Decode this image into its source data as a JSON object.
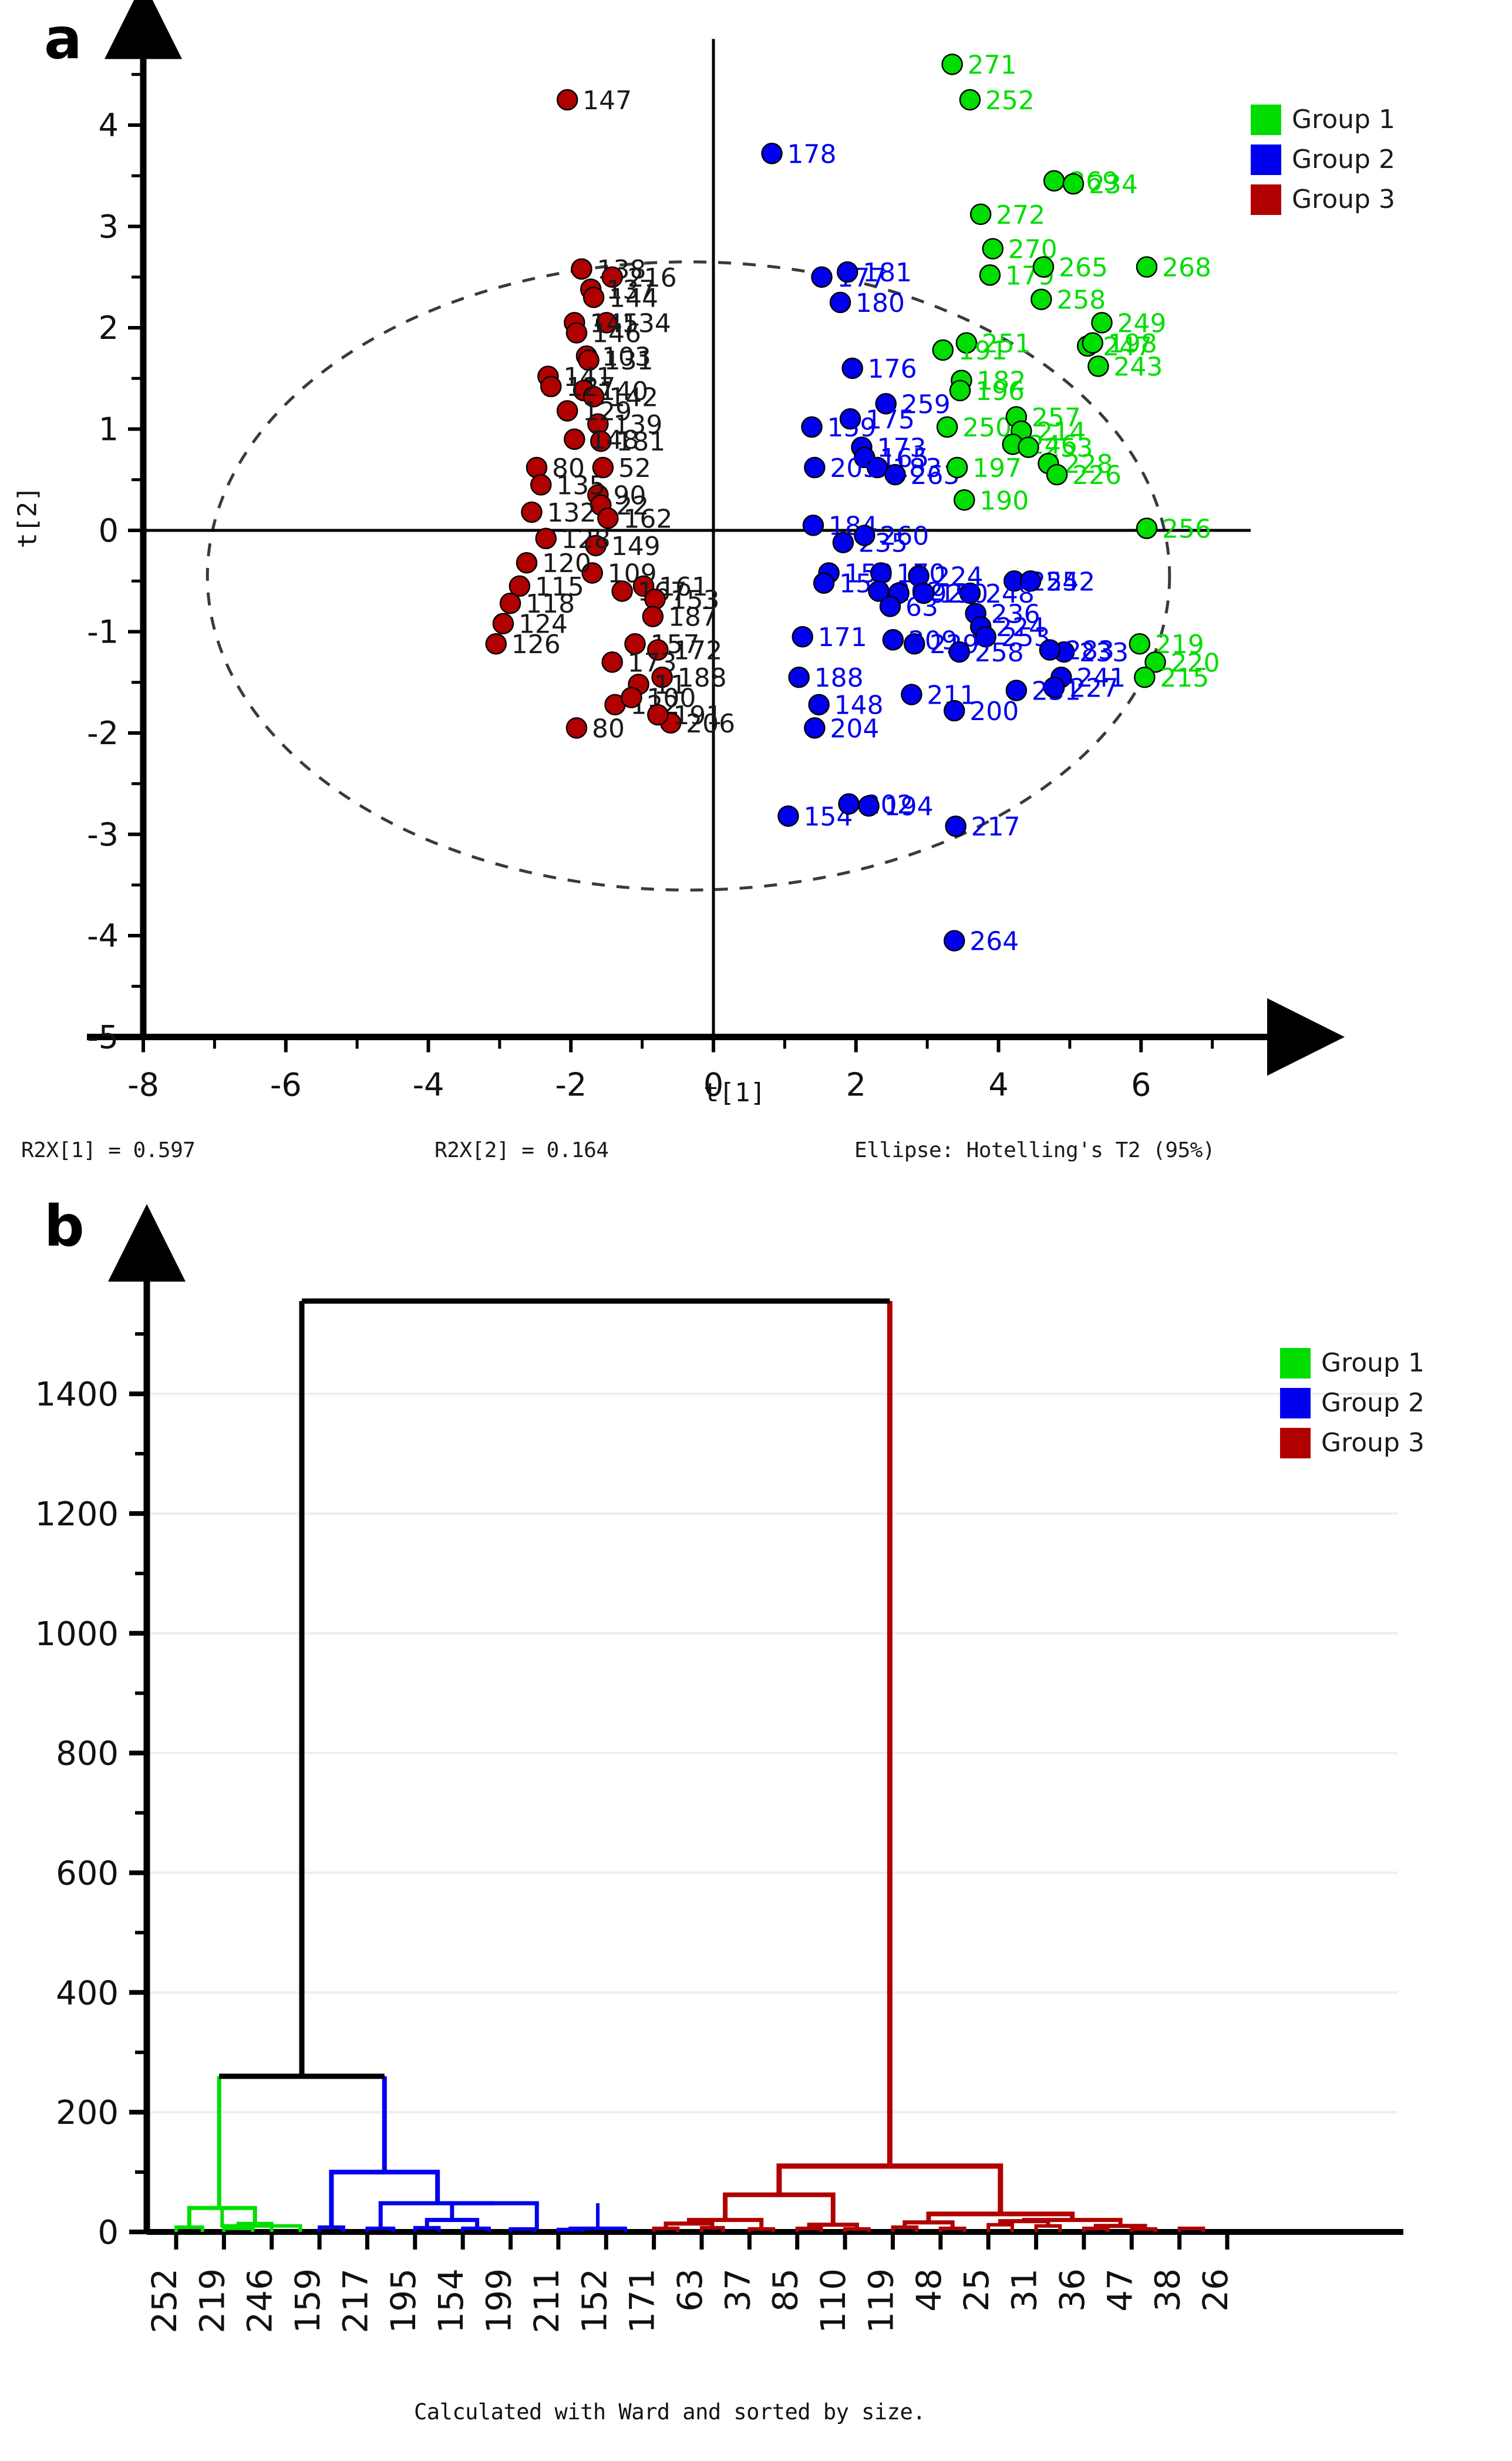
{
  "figure": {
    "panel_a_letter": "a",
    "panel_b_letter": "b"
  },
  "legend": {
    "items": [
      {
        "label": "Group 1",
        "color": "#00dd00"
      },
      {
        "label": "Group 2",
        "color": "#0000ee"
      },
      {
        "label": "Group 3",
        "color": "#b00000"
      }
    ]
  },
  "panel_a": {
    "stats": {
      "r2x1": "R2X[1] = 0.597",
      "r2x2": "R2X[2] = 0.164",
      "ellipse": "Ellipse: Hotelling's T2 (95%)"
    },
    "chart_data": {
      "type": "scatter",
      "title": "",
      "xlabel": "t[1]",
      "ylabel": "t[2]",
      "xlim": [
        -8,
        7
      ],
      "ylim": [
        -5,
        4.8
      ],
      "xticks": [
        -8,
        -6,
        -4,
        -2,
        0,
        2,
        4,
        6
      ],
      "yticks": [
        -5,
        -4,
        -3,
        -2,
        -1,
        0,
        1,
        2,
        3,
        4
      ],
      "grid": false,
      "legend_position": "top-right",
      "annotations": [
        "Hotelling's T2 95% confidence ellipse (dashed)"
      ],
      "ellipse": {
        "cx": -0.35,
        "cy": -0.45,
        "rx": 6.75,
        "ry": 3.1
      },
      "series": [
        {
          "name": "Group 1",
          "color": "#00dd00",
          "points": [
            {
              "label": "271",
              "x": 3.35,
              "y": 4.6
            },
            {
              "label": "252",
              "x": 3.6,
              "y": 4.25
            },
            {
              "label": "269",
              "x": 4.78,
              "y": 3.45
            },
            {
              "label": "234",
              "x": 5.05,
              "y": 3.42
            },
            {
              "label": "272",
              "x": 3.75,
              "y": 3.12
            },
            {
              "label": "270",
              "x": 3.92,
              "y": 2.78
            },
            {
              "label": "179",
              "x": 3.88,
              "y": 2.52
            },
            {
              "label": "265",
              "x": 4.63,
              "y": 2.6
            },
            {
              "label": "258",
              "x": 4.6,
              "y": 2.28
            },
            {
              "label": "268",
              "x": 6.08,
              "y": 2.6
            },
            {
              "label": "249",
              "x": 5.45,
              "y": 2.05
            },
            {
              "label": "247",
              "x": 5.25,
              "y": 1.82
            },
            {
              "label": "198",
              "x": 5.32,
              "y": 1.85
            },
            {
              "label": "243",
              "x": 5.4,
              "y": 1.62
            },
            {
              "label": "251",
              "x": 3.55,
              "y": 1.85
            },
            {
              "label": "191",
              "x": 3.22,
              "y": 1.78
            },
            {
              "label": "182",
              "x": 3.48,
              "y": 1.48
            },
            {
              "label": "196",
              "x": 3.46,
              "y": 1.38
            },
            {
              "label": "250",
              "x": 3.28,
              "y": 1.02
            },
            {
              "label": "257",
              "x": 4.25,
              "y": 1.12
            },
            {
              "label": "214",
              "x": 4.32,
              "y": 0.98
            },
            {
              "label": "246",
              "x": 4.2,
              "y": 0.85
            },
            {
              "label": "253",
              "x": 4.42,
              "y": 0.82
            },
            {
              "label": "228",
              "x": 4.7,
              "y": 0.66
            },
            {
              "label": "226",
              "x": 4.82,
              "y": 0.55
            },
            {
              "label": "197",
              "x": 3.42,
              "y": 0.62
            },
            {
              "label": "190",
              "x": 3.52,
              "y": 0.3
            },
            {
              "label": "256",
              "x": 6.08,
              "y": 0.02
            },
            {
              "label": "219",
              "x": 5.98,
              "y": -1.12
            },
            {
              "label": "220",
              "x": 6.2,
              "y": -1.3
            },
            {
              "label": "215",
              "x": 6.05,
              "y": -1.45
            }
          ]
        },
        {
          "name": "Group 2",
          "color": "#0000ee",
          "points": [
            {
              "label": "178",
              "x": 0.82,
              "y": 3.72
            },
            {
              "label": "177",
              "x": 1.52,
              "y": 2.5
            },
            {
              "label": "181",
              "x": 1.88,
              "y": 2.55
            },
            {
              "label": "180",
              "x": 1.78,
              "y": 2.25
            },
            {
              "label": "176",
              "x": 1.95,
              "y": 1.6
            },
            {
              "label": "259",
              "x": 2.42,
              "y": 1.25
            },
            {
              "label": "175",
              "x": 1.92,
              "y": 1.1
            },
            {
              "label": "159",
              "x": 1.38,
              "y": 1.02
            },
            {
              "label": "173",
              "x": 2.08,
              "y": 0.82
            },
            {
              "label": "165",
              "x": 2.12,
              "y": 0.72
            },
            {
              "label": "183",
              "x": 2.3,
              "y": 0.62
            },
            {
              "label": "205",
              "x": 1.42,
              "y": 0.62
            },
            {
              "label": "263",
              "x": 2.55,
              "y": 0.55
            },
            {
              "label": "184",
              "x": 1.4,
              "y": 0.05
            },
            {
              "label": "235",
              "x": 1.82,
              "y": -0.12
            },
            {
              "label": "260",
              "x": 2.12,
              "y": -0.05
            },
            {
              "label": "150",
              "x": 1.62,
              "y": -0.42
            },
            {
              "label": "158",
              "x": 1.55,
              "y": -0.52
            },
            {
              "label": "170",
              "x": 2.35,
              "y": -0.42
            },
            {
              "label": "224",
              "x": 2.88,
              "y": -0.45
            },
            {
              "label": "255",
              "x": 4.22,
              "y": -0.5
            },
            {
              "label": "242",
              "x": 4.45,
              "y": -0.5
            },
            {
              "label": "248",
              "x": 3.6,
              "y": -0.62
            },
            {
              "label": "262",
              "x": 2.32,
              "y": -0.6
            },
            {
              "label": "192",
              "x": 2.6,
              "y": -0.62
            },
            {
              "label": "190b",
              "x": 2.95,
              "y": -0.62
            },
            {
              "label": "236",
              "x": 3.68,
              "y": -0.82
            },
            {
              "label": "63",
              "x": 2.48,
              "y": -0.75
            },
            {
              "label": "224b",
              "x": 3.75,
              "y": -0.95
            },
            {
              "label": "253b",
              "x": 3.82,
              "y": -1.05
            },
            {
              "label": "171",
              "x": 1.25,
              "y": -1.05
            },
            {
              "label": "209",
              "x": 2.52,
              "y": -1.08
            },
            {
              "label": "229",
              "x": 2.82,
              "y": -1.12
            },
            {
              "label": "258b",
              "x": 3.45,
              "y": -1.2
            },
            {
              "label": "233",
              "x": 4.92,
              "y": -1.2
            },
            {
              "label": "283",
              "x": 4.72,
              "y": -1.18
            },
            {
              "label": "241",
              "x": 4.88,
              "y": -1.45
            },
            {
              "label": "227",
              "x": 4.78,
              "y": -1.55
            },
            {
              "label": "231",
              "x": 4.25,
              "y": -1.58
            },
            {
              "label": "188",
              "x": 1.2,
              "y": -1.45
            },
            {
              "label": "211",
              "x": 2.78,
              "y": -1.62
            },
            {
              "label": "200",
              "x": 3.38,
              "y": -1.78
            },
            {
              "label": "148",
              "x": 1.48,
              "y": -1.72
            },
            {
              "label": "204",
              "x": 1.42,
              "y": -1.95
            },
            {
              "label": "154",
              "x": 1.05,
              "y": -2.82
            },
            {
              "label": "202",
              "x": 1.9,
              "y": -2.7
            },
            {
              "label": "194",
              "x": 2.18,
              "y": -2.72
            },
            {
              "label": "217",
              "x": 3.4,
              "y": -2.92
            },
            {
              "label": "264",
              "x": 3.38,
              "y": -4.05
            }
          ]
        },
        {
          "name": "Group 3",
          "color": "#b00000",
          "points": [
            {
              "label": "147",
              "x": -2.05,
              "y": 4.25
            },
            {
              "label": "138",
              "x": -1.85,
              "y": 2.58
            },
            {
              "label": "216",
              "x": -1.42,
              "y": 2.5
            },
            {
              "label": "137",
              "x": -1.72,
              "y": 2.38
            },
            {
              "label": "144",
              "x": -1.68,
              "y": 2.3
            },
            {
              "label": "134",
              "x": -1.5,
              "y": 2.05
            },
            {
              "label": "145",
              "x": -1.95,
              "y": 2.05
            },
            {
              "label": "146",
              "x": -1.92,
              "y": 1.95
            },
            {
              "label": "103",
              "x": -1.78,
              "y": 1.72
            },
            {
              "label": "131",
              "x": -1.75,
              "y": 1.68
            },
            {
              "label": "141",
              "x": -2.32,
              "y": 1.52
            },
            {
              "label": "140",
              "x": -1.82,
              "y": 1.38
            },
            {
              "label": "142",
              "x": -1.68,
              "y": 1.32
            },
            {
              "label": "139",
              "x": -1.62,
              "y": 1.05
            },
            {
              "label": "181r",
              "x": -1.58,
              "y": 0.88
            },
            {
              "label": "148r",
              "x": -1.95,
              "y": 0.9
            },
            {
              "label": "52",
              "x": -1.55,
              "y": 0.62
            },
            {
              "label": "80a",
              "x": -2.48,
              "y": 0.62
            },
            {
              "label": "90",
              "x": -1.62,
              "y": 0.35
            },
            {
              "label": "22",
              "x": -1.58,
              "y": 0.25
            },
            {
              "label": "162",
              "x": -1.48,
              "y": 0.12
            },
            {
              "label": "149",
              "x": -1.65,
              "y": -0.15
            },
            {
              "label": "109",
              "x": -1.7,
              "y": -0.42
            },
            {
              "label": "161",
              "x": -0.98,
              "y": -0.55
            },
            {
              "label": "167",
              "x": -1.28,
              "y": -0.6
            },
            {
              "label": "153",
              "x": -0.82,
              "y": -0.68
            },
            {
              "label": "187",
              "x": -0.85,
              "y": -0.85
            },
            {
              "label": "157",
              "x": -1.1,
              "y": -1.12
            },
            {
              "label": "172",
              "x": -0.78,
              "y": -1.18
            },
            {
              "label": "173r",
              "x": -1.42,
              "y": -1.3
            },
            {
              "label": "188r",
              "x": -0.72,
              "y": -1.45
            },
            {
              "label": "122",
              "x": -1.38,
              "y": -1.72
            },
            {
              "label": "11",
              "x": -1.05,
              "y": -1.52
            },
            {
              "label": "100",
              "x": -1.15,
              "y": -1.65
            },
            {
              "label": "80",
              "x": -1.92,
              "y": -1.95
            },
            {
              "label": "206",
              "x": -0.6,
              "y": -1.9
            },
            {
              "label": "191r",
              "x": -0.78,
              "y": -1.82
            },
            {
              "label": "120",
              "x": -2.62,
              "y": -0.32
            },
            {
              "label": "115",
              "x": -2.72,
              "y": -0.55
            },
            {
              "label": "118",
              "x": -2.85,
              "y": -0.72
            },
            {
              "label": "124",
              "x": -2.95,
              "y": -0.92
            },
            {
              "label": "126",
              "x": -3.05,
              "y": -1.12
            },
            {
              "label": "128",
              "x": -2.35,
              "y": -0.08
            },
            {
              "label": "132",
              "x": -2.55,
              "y": 0.18
            },
            {
              "label": "135",
              "x": -2.42,
              "y": 0.45
            },
            {
              "label": "129",
              "x": -2.05,
              "y": 1.18
            },
            {
              "label": "127",
              "x": -2.28,
              "y": 1.42
            }
          ]
        }
      ]
    }
  },
  "panel_b": {
    "caption": "Calculated with Ward and sorted by size.",
    "chart_data": {
      "type": "dendrogram",
      "title": "",
      "xlabel": "",
      "ylabel": "",
      "ylim": [
        0,
        1560
      ],
      "yticks": [
        0,
        200,
        400,
        600,
        800,
        1000,
        1200,
        1400
      ],
      "grid": true,
      "legend_position": "top-right",
      "leaf_labels": [
        "252",
        "219",
        "246",
        "159",
        "217",
        "195",
        "154",
        "199",
        "211",
        "152",
        "171",
        "63",
        "37",
        "85",
        "110",
        "119",
        "48",
        "25",
        "31",
        "36",
        "47",
        "38",
        "26"
      ],
      "cluster_colors": {
        "green": "#00dd00",
        "blue": "#0000ee",
        "red": "#b00000",
        "root": "#000000"
      },
      "merge_heights": {
        "root": 1555,
        "green_blue": 260,
        "green_top": 40,
        "blue_top": 100,
        "blue_second": 48,
        "red_top": 110,
        "red_left": 62,
        "red_right": 30
      }
    }
  }
}
